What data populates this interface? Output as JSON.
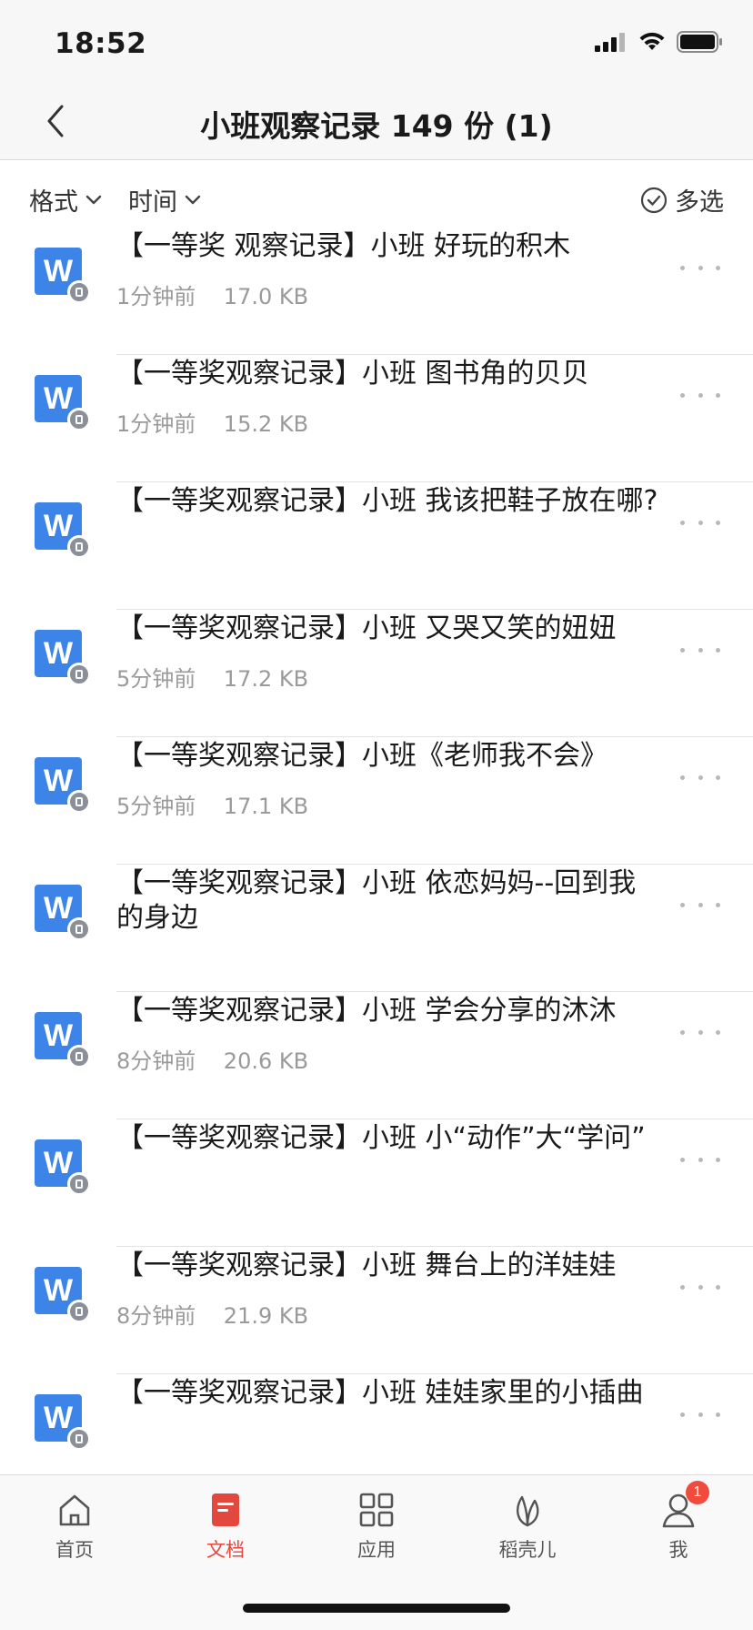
{
  "status_bar": {
    "time": "18:52",
    "icons": [
      "cellular-signal-icon",
      "wifi-icon",
      "battery-icon"
    ]
  },
  "nav": {
    "title": "小班观察记录 149 份 (1)",
    "back_icon": "chevron-left-icon"
  },
  "filters": {
    "format_label": "格式",
    "time_label": "时间",
    "multi_select_label": "多选"
  },
  "files": [
    {
      "name": "【一等奖 观察记录】小班 好玩的积木",
      "time": "1分钟前",
      "size": "17.0 KB"
    },
    {
      "name": "【一等奖观察记录】小班 图书角的贝贝",
      "time": "1分钟前",
      "size": "15.2 KB"
    },
    {
      "name": "【一等奖观察记录】小班 我该把鞋子放在哪?",
      "time": "",
      "size": ""
    },
    {
      "name": "【一等奖观察记录】小班 又哭又笑的妞妞",
      "time": "5分钟前",
      "size": "17.2 KB"
    },
    {
      "name": "【一等奖观察记录】小班《老师我不会》",
      "time": "5分钟前",
      "size": "17.1 KB"
    },
    {
      "name": "【一等奖观察记录】小班 依恋妈妈--回到我的身边",
      "time": "",
      "size": ""
    },
    {
      "name": "【一等奖观察记录】小班 学会分享的沐沐",
      "time": "8分钟前",
      "size": "20.6 KB"
    },
    {
      "name": "【一等奖观察记录】小班 小“动作”大“学问”",
      "time": "",
      "size": ""
    },
    {
      "name": "【一等奖观察记录】小班 舞台上的洋娃娃",
      "time": "8分钟前",
      "size": "21.9 KB"
    },
    {
      "name": "【一等奖观察记录】小班 娃娃家里的小插曲",
      "time": "",
      "size": ""
    }
  ],
  "tabs": [
    {
      "label": "首页",
      "icon": "home-icon",
      "active": false
    },
    {
      "label": "文档",
      "icon": "document-icon",
      "active": true
    },
    {
      "label": "应用",
      "icon": "apps-grid-icon",
      "active": false
    },
    {
      "label": "稻壳儿",
      "icon": "leaf-icon",
      "active": false
    },
    {
      "label": "我",
      "icon": "profile-icon",
      "active": false,
      "badge": "1"
    }
  ],
  "colors": {
    "accent": "#e2483d",
    "wps_blue": "#3d84e8",
    "meta_gray": "#9a9a9a"
  }
}
